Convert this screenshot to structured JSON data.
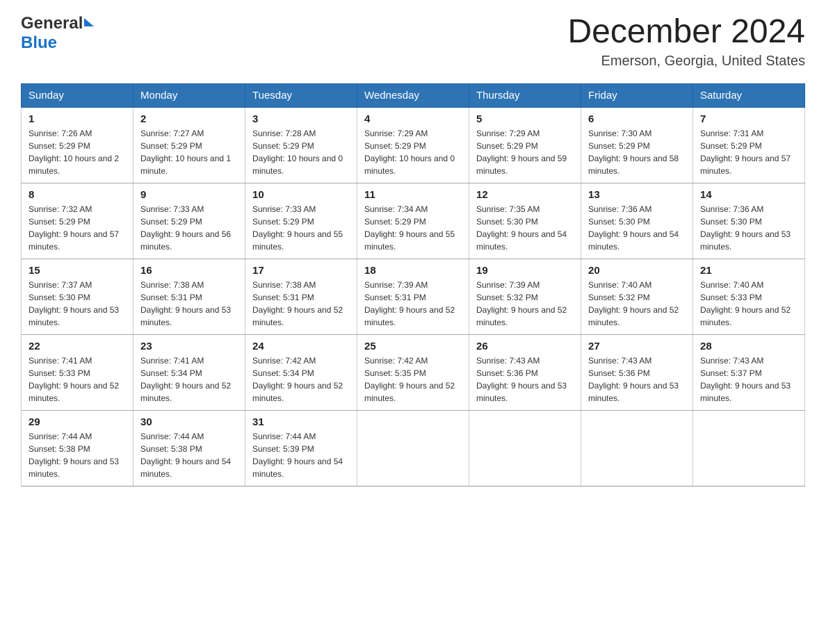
{
  "header": {
    "logo_general": "General",
    "logo_blue": "Blue",
    "month_title": "December 2024",
    "location": "Emerson, Georgia, United States"
  },
  "days_of_week": [
    "Sunday",
    "Monday",
    "Tuesday",
    "Wednesday",
    "Thursday",
    "Friday",
    "Saturday"
  ],
  "weeks": [
    [
      {
        "day": "1",
        "sunrise": "7:26 AM",
        "sunset": "5:29 PM",
        "daylight": "10 hours and 2 minutes."
      },
      {
        "day": "2",
        "sunrise": "7:27 AM",
        "sunset": "5:29 PM",
        "daylight": "10 hours and 1 minute."
      },
      {
        "day": "3",
        "sunrise": "7:28 AM",
        "sunset": "5:29 PM",
        "daylight": "10 hours and 0 minutes."
      },
      {
        "day": "4",
        "sunrise": "7:29 AM",
        "sunset": "5:29 PM",
        "daylight": "10 hours and 0 minutes."
      },
      {
        "day": "5",
        "sunrise": "7:29 AM",
        "sunset": "5:29 PM",
        "daylight": "9 hours and 59 minutes."
      },
      {
        "day": "6",
        "sunrise": "7:30 AM",
        "sunset": "5:29 PM",
        "daylight": "9 hours and 58 minutes."
      },
      {
        "day": "7",
        "sunrise": "7:31 AM",
        "sunset": "5:29 PM",
        "daylight": "9 hours and 57 minutes."
      }
    ],
    [
      {
        "day": "8",
        "sunrise": "7:32 AM",
        "sunset": "5:29 PM",
        "daylight": "9 hours and 57 minutes."
      },
      {
        "day": "9",
        "sunrise": "7:33 AM",
        "sunset": "5:29 PM",
        "daylight": "9 hours and 56 minutes."
      },
      {
        "day": "10",
        "sunrise": "7:33 AM",
        "sunset": "5:29 PM",
        "daylight": "9 hours and 55 minutes."
      },
      {
        "day": "11",
        "sunrise": "7:34 AM",
        "sunset": "5:29 PM",
        "daylight": "9 hours and 55 minutes."
      },
      {
        "day": "12",
        "sunrise": "7:35 AM",
        "sunset": "5:30 PM",
        "daylight": "9 hours and 54 minutes."
      },
      {
        "day": "13",
        "sunrise": "7:36 AM",
        "sunset": "5:30 PM",
        "daylight": "9 hours and 54 minutes."
      },
      {
        "day": "14",
        "sunrise": "7:36 AM",
        "sunset": "5:30 PM",
        "daylight": "9 hours and 53 minutes."
      }
    ],
    [
      {
        "day": "15",
        "sunrise": "7:37 AM",
        "sunset": "5:30 PM",
        "daylight": "9 hours and 53 minutes."
      },
      {
        "day": "16",
        "sunrise": "7:38 AM",
        "sunset": "5:31 PM",
        "daylight": "9 hours and 53 minutes."
      },
      {
        "day": "17",
        "sunrise": "7:38 AM",
        "sunset": "5:31 PM",
        "daylight": "9 hours and 52 minutes."
      },
      {
        "day": "18",
        "sunrise": "7:39 AM",
        "sunset": "5:31 PM",
        "daylight": "9 hours and 52 minutes."
      },
      {
        "day": "19",
        "sunrise": "7:39 AM",
        "sunset": "5:32 PM",
        "daylight": "9 hours and 52 minutes."
      },
      {
        "day": "20",
        "sunrise": "7:40 AM",
        "sunset": "5:32 PM",
        "daylight": "9 hours and 52 minutes."
      },
      {
        "day": "21",
        "sunrise": "7:40 AM",
        "sunset": "5:33 PM",
        "daylight": "9 hours and 52 minutes."
      }
    ],
    [
      {
        "day": "22",
        "sunrise": "7:41 AM",
        "sunset": "5:33 PM",
        "daylight": "9 hours and 52 minutes."
      },
      {
        "day": "23",
        "sunrise": "7:41 AM",
        "sunset": "5:34 PM",
        "daylight": "9 hours and 52 minutes."
      },
      {
        "day": "24",
        "sunrise": "7:42 AM",
        "sunset": "5:34 PM",
        "daylight": "9 hours and 52 minutes."
      },
      {
        "day": "25",
        "sunrise": "7:42 AM",
        "sunset": "5:35 PM",
        "daylight": "9 hours and 52 minutes."
      },
      {
        "day": "26",
        "sunrise": "7:43 AM",
        "sunset": "5:36 PM",
        "daylight": "9 hours and 53 minutes."
      },
      {
        "day": "27",
        "sunrise": "7:43 AM",
        "sunset": "5:36 PM",
        "daylight": "9 hours and 53 minutes."
      },
      {
        "day": "28",
        "sunrise": "7:43 AM",
        "sunset": "5:37 PM",
        "daylight": "9 hours and 53 minutes."
      }
    ],
    [
      {
        "day": "29",
        "sunrise": "7:44 AM",
        "sunset": "5:38 PM",
        "daylight": "9 hours and 53 minutes."
      },
      {
        "day": "30",
        "sunrise": "7:44 AM",
        "sunset": "5:38 PM",
        "daylight": "9 hours and 54 minutes."
      },
      {
        "day": "31",
        "sunrise": "7:44 AM",
        "sunset": "5:39 PM",
        "daylight": "9 hours and 54 minutes."
      },
      null,
      null,
      null,
      null
    ]
  ],
  "labels": {
    "sunrise": "Sunrise:",
    "sunset": "Sunset:",
    "daylight": "Daylight:"
  }
}
